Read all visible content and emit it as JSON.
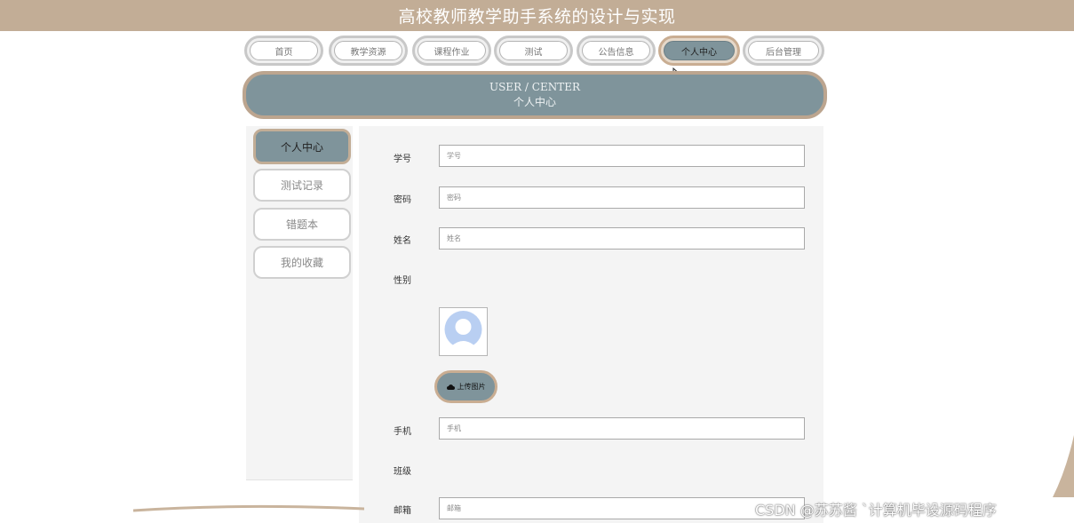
{
  "app": {
    "title": "高校教师教学助手系统的设计与实现"
  },
  "nav": {
    "items": [
      {
        "label": "首页",
        "active": false
      },
      {
        "label": "教学资源",
        "active": false
      },
      {
        "label": "课程作业",
        "active": false
      },
      {
        "label": "测试",
        "active": false
      },
      {
        "label": "公告信息",
        "active": false
      },
      {
        "label": "个人中心",
        "active": true
      },
      {
        "label": "后台管理",
        "active": false
      }
    ]
  },
  "banner": {
    "en": "USER / CENTER",
    "cn": "个人中心"
  },
  "sidebar": {
    "items": [
      {
        "label": "个人中心",
        "active": true
      },
      {
        "label": "测试记录",
        "active": false
      },
      {
        "label": "错题本",
        "active": false
      },
      {
        "label": "我的收藏",
        "active": false
      }
    ]
  },
  "form": {
    "student_id": {
      "label": "学号",
      "placeholder": "学号",
      "value": ""
    },
    "password": {
      "label": "密码",
      "placeholder": "密码",
      "value": ""
    },
    "name": {
      "label": "姓名",
      "placeholder": "姓名",
      "value": ""
    },
    "gender": {
      "label": "性别"
    },
    "upload_button": "上传图片",
    "phone": {
      "label": "手机",
      "placeholder": "手机",
      "value": ""
    },
    "class": {
      "label": "班级"
    },
    "email": {
      "label": "邮箱",
      "placeholder": "邮箱",
      "value": ""
    }
  },
  "watermark": "CSDN @苏苏酱   `计算机毕设源码程序",
  "theme": {
    "accent": "#7f949b",
    "header": "#c2ad96",
    "border_gold": "#c9ad92"
  }
}
